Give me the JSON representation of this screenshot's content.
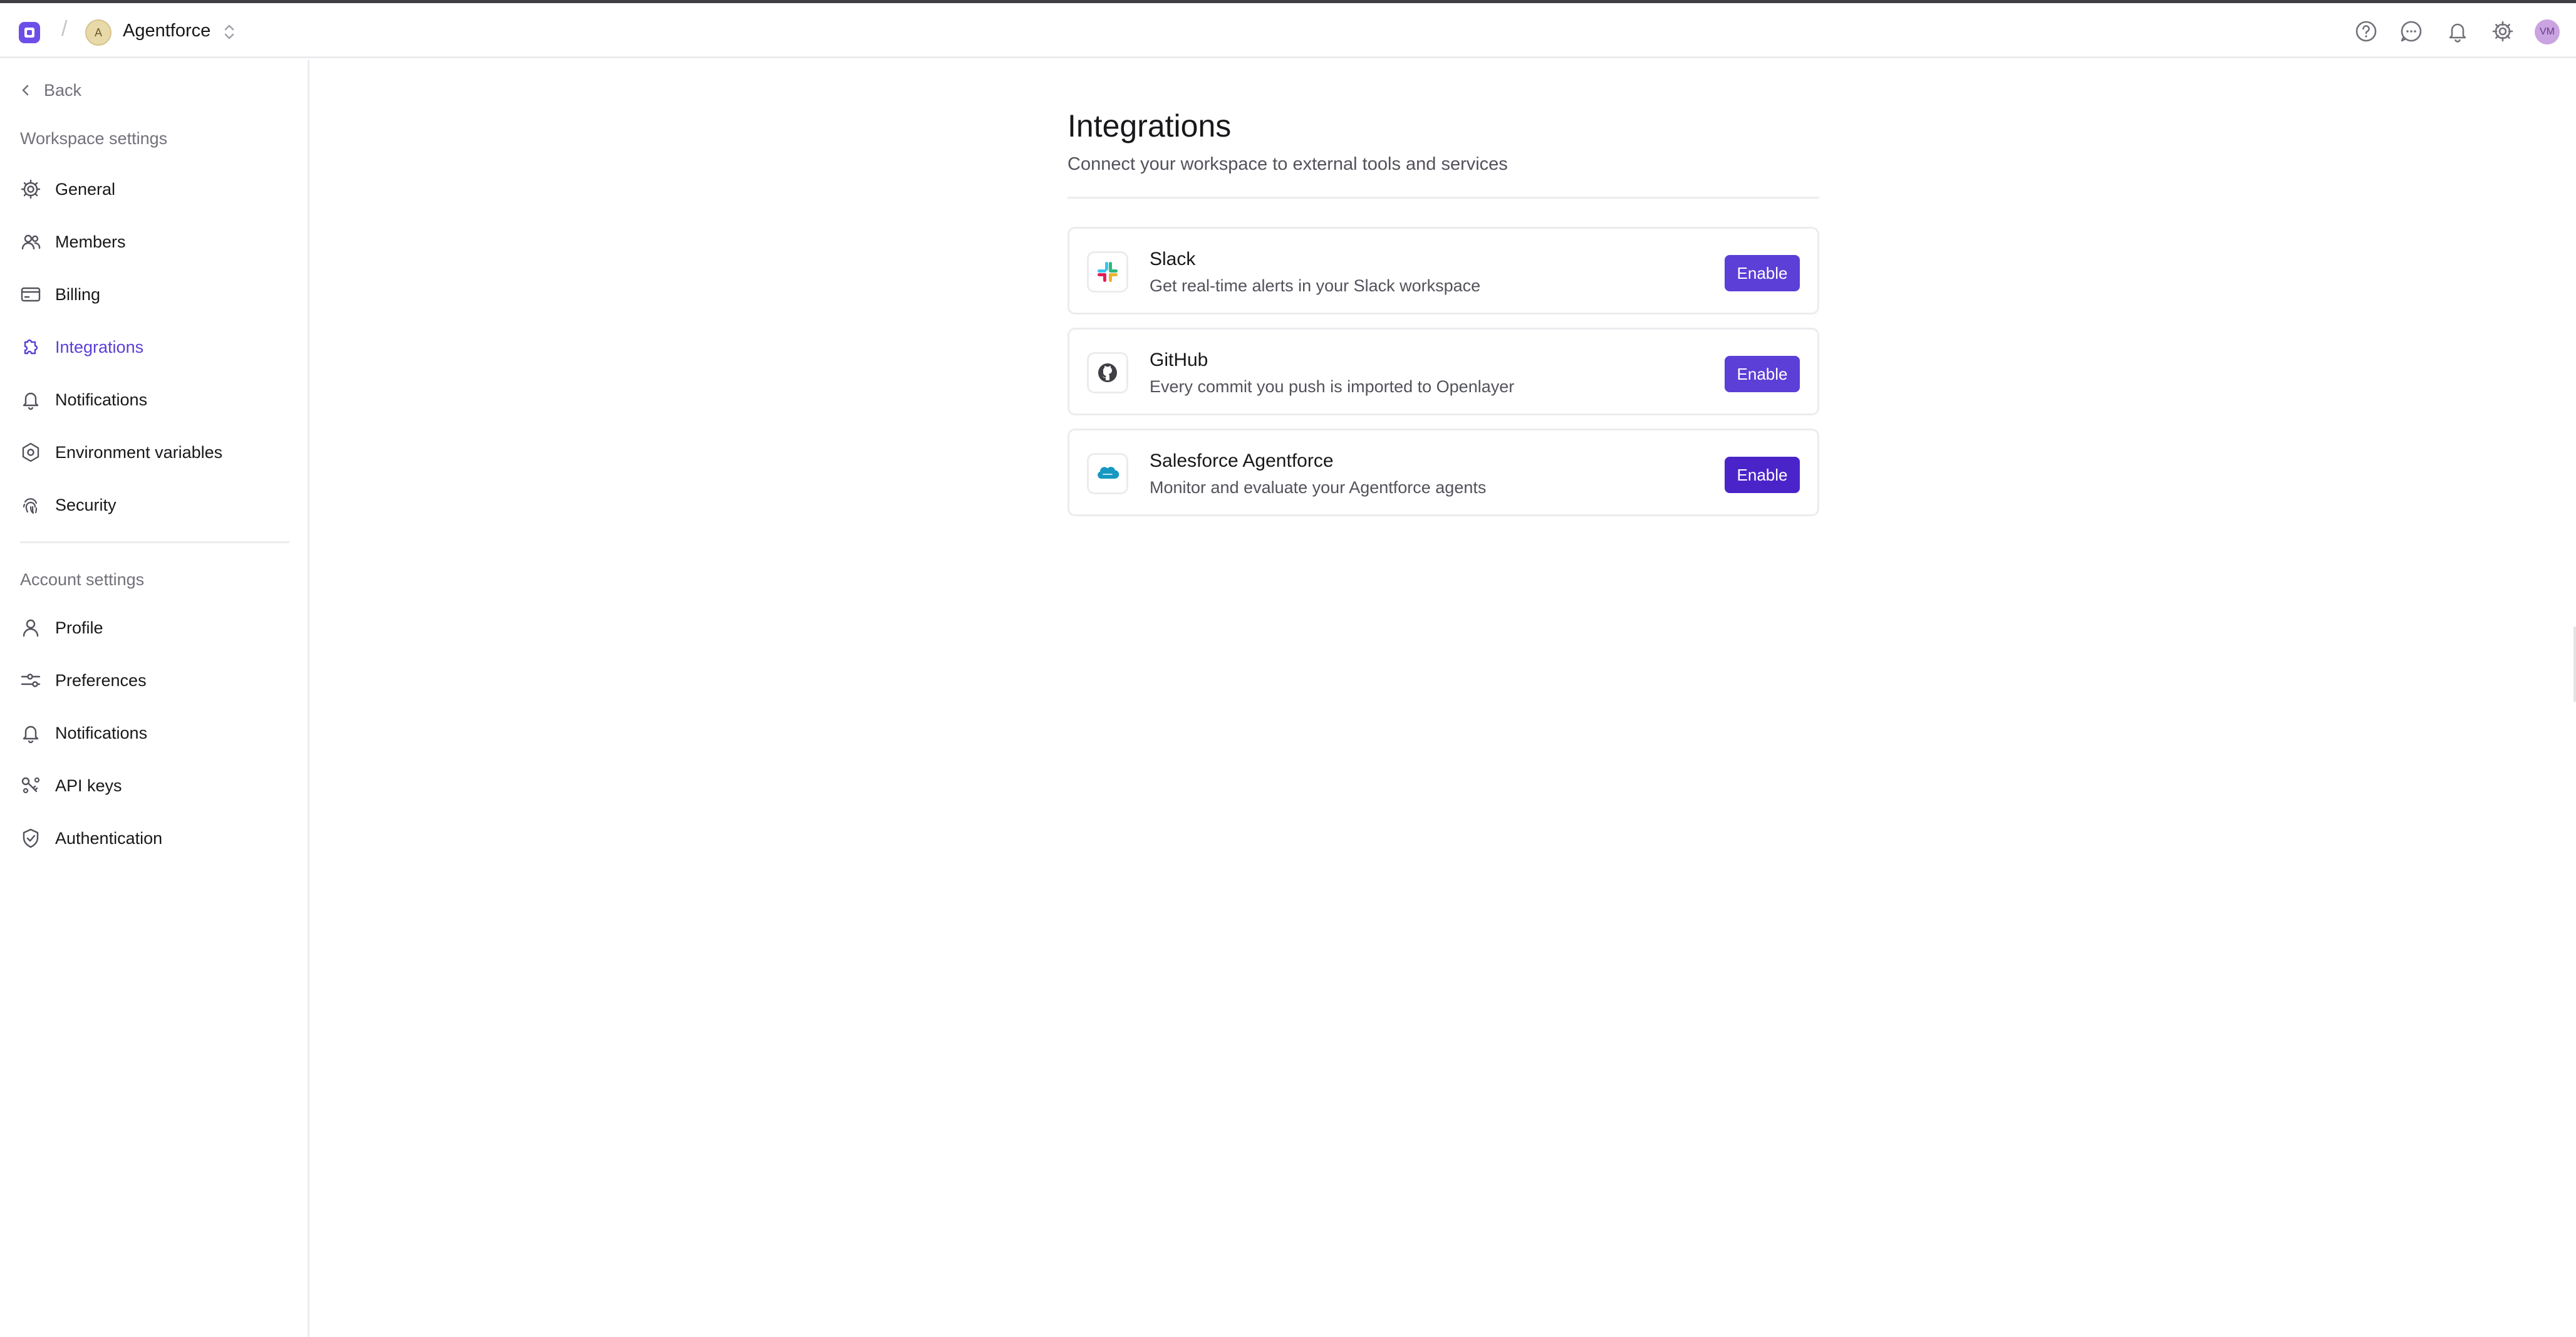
{
  "topbar": {
    "workspace_initial": "A",
    "workspace_name": "Agentforce",
    "separator": "/",
    "user_initials": "VM"
  },
  "sidebar": {
    "back_label": "Back",
    "workspace_section": "Workspace settings",
    "workspace_items": [
      {
        "label": "General",
        "icon": "gear-icon"
      },
      {
        "label": "Members",
        "icon": "users-icon"
      },
      {
        "label": "Billing",
        "icon": "credit-card-icon"
      },
      {
        "label": "Integrations",
        "icon": "puzzle-icon",
        "active": true
      },
      {
        "label": "Notifications",
        "icon": "bell-icon"
      },
      {
        "label": "Environment variables",
        "icon": "hexagon-cog-icon"
      },
      {
        "label": "Security",
        "icon": "fingerprint-icon"
      }
    ],
    "account_section": "Account settings",
    "account_items": [
      {
        "label": "Profile",
        "icon": "user-icon"
      },
      {
        "label": "Preferences",
        "icon": "sliders-icon"
      },
      {
        "label": "Notifications",
        "icon": "bell-icon"
      },
      {
        "label": "API keys",
        "icon": "key-icon"
      },
      {
        "label": "Authentication",
        "icon": "shield-check-icon"
      }
    ]
  },
  "main": {
    "title": "Integrations",
    "subtitle": "Connect your workspace to external tools and services",
    "integrations": [
      {
        "name": "Slack",
        "description": "Get real-time alerts in your Slack workspace",
        "button": "Enable",
        "icon": "slack-icon"
      },
      {
        "name": "GitHub",
        "description": "Every commit you push is imported to Openlayer",
        "button": "Enable",
        "icon": "github-icon"
      },
      {
        "name": "Salesforce Agentforce",
        "description": "Monitor and evaluate your Agentforce agents",
        "button": "Enable",
        "icon": "salesforce-icon"
      }
    ]
  },
  "colors": {
    "accent": "#5b3fd6",
    "accent_dark": "#4a24c9",
    "border": "#ececef",
    "muted_text": "#71717a"
  }
}
